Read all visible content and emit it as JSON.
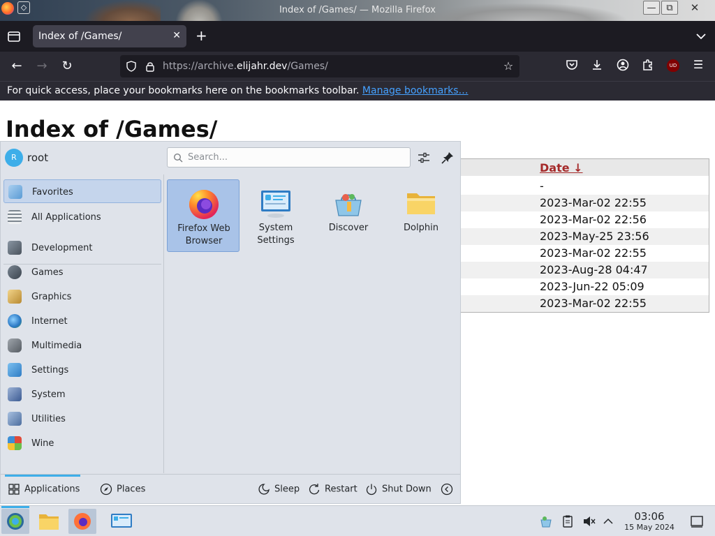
{
  "window": {
    "title": "Index of /Games/ — Mozilla Firefox",
    "min_glyph": "—",
    "max_glyph": "⧉",
    "close_glyph": "✕"
  },
  "browser": {
    "tab_title": "Index of /Games/",
    "tab_close_glyph": "✕",
    "new_tab_glyph": "+",
    "url_prefix": "https://archive.",
    "url_host": "elijahr.dev",
    "url_path": "/Games/",
    "bookmarks_message": "For quick access, place your bookmarks here on the bookmarks toolbar.",
    "bookmarks_link": "Manage bookmarks…",
    "extension_badge": "UD"
  },
  "page": {
    "heading": "Index of /Games/",
    "listing": {
      "date_header": "Date ↓",
      "dates": [
        "-",
        "2023-Mar-02 22:55",
        "2023-Mar-02 22:56",
        "2023-May-25 23:56",
        "2023-Mar-02 22:55",
        "2023-Aug-28 04:47",
        "2023-Jun-22 05:09",
        "2023-Mar-02 22:55"
      ]
    }
  },
  "launcher": {
    "avatar_initial": "R",
    "username": "root",
    "search_placeholder": "Search...",
    "categories": [
      {
        "label": "Favorites",
        "icon": "favorites-icon",
        "color": "#7ab0e0"
      },
      {
        "label": "All Applications",
        "icon": "all-applications-icon",
        "color": "#9aa4ae"
      },
      {
        "label": "Development",
        "icon": "development-icon",
        "color": "#6a7480"
      },
      {
        "label": "Games",
        "icon": "games-icon",
        "color": "#5a6470"
      },
      {
        "label": "Graphics",
        "icon": "graphics-icon",
        "color": "#d8b25a"
      },
      {
        "label": "Internet",
        "icon": "internet-icon",
        "color": "#3c8fd6"
      },
      {
        "label": "Multimedia",
        "icon": "multimedia-icon",
        "color": "#7a8088"
      },
      {
        "label": "Settings",
        "icon": "settings-icon",
        "color": "#4a90d0"
      },
      {
        "label": "System",
        "icon": "system-icon",
        "color": "#5577aa"
      },
      {
        "label": "Utilities",
        "icon": "utilities-icon",
        "color": "#6a86b0"
      },
      {
        "label": "Wine",
        "icon": "wine-icon",
        "color": "#d9463a"
      }
    ],
    "apps": [
      {
        "label": "Firefox Web Browser",
        "icon": "firefox-icon"
      },
      {
        "label": "System Settings",
        "icon": "system-settings-icon"
      },
      {
        "label": "Discover",
        "icon": "discover-icon"
      },
      {
        "label": "Dolphin",
        "icon": "dolphin-folder-icon"
      }
    ],
    "footer": {
      "applications": "Applications",
      "places": "Places",
      "sleep": "Sleep",
      "restart": "Restart",
      "shutdown": "Shut Down"
    }
  },
  "taskbar": {
    "time": "03:06",
    "date": "15 May 2024"
  },
  "colors": {
    "accent": "#3daee9",
    "link": "#45a1ff",
    "date_header": "#a52a2a"
  }
}
